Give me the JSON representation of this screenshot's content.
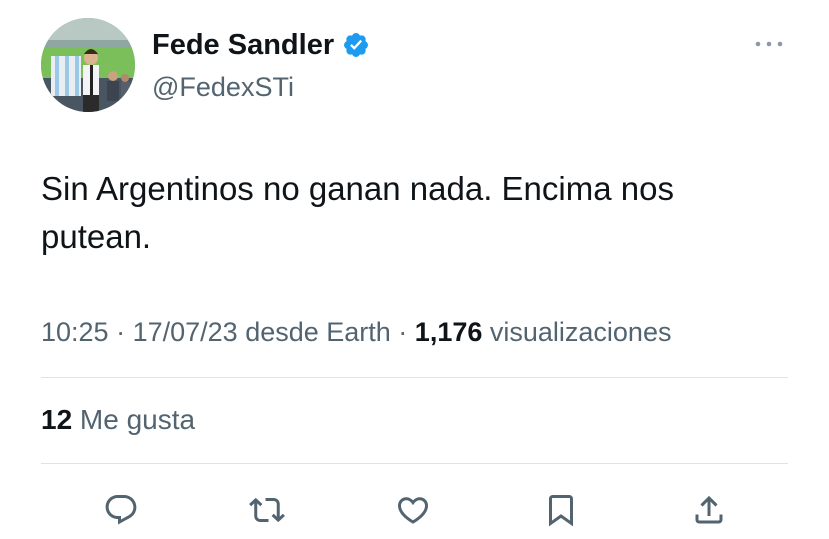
{
  "author": {
    "display_name": "Fede Sandler",
    "handle": "@FedexSTi",
    "verified": true,
    "verified_color": "#1d9bf0"
  },
  "tweet": {
    "text": "Sin Argentinos no ganan nada. Encima nos putean."
  },
  "meta": {
    "time": "10:25",
    "sep1": " · ",
    "date": "17/07/23",
    "source": " desde Earth",
    "sep2": " · ",
    "views_count": "1,176",
    "views_label": " visualizaciones"
  },
  "likes": {
    "count": "12",
    "label": " Me gusta"
  },
  "actions": {
    "reply": "reply-icon",
    "retweet": "retweet-icon",
    "like": "heart-icon",
    "bookmark": "bookmark-icon",
    "share": "share-icon"
  },
  "colors": {
    "text": "#0f1419",
    "secondary": "#536471",
    "divider": "#dfe3e6",
    "accent": "#1d9bf0"
  }
}
